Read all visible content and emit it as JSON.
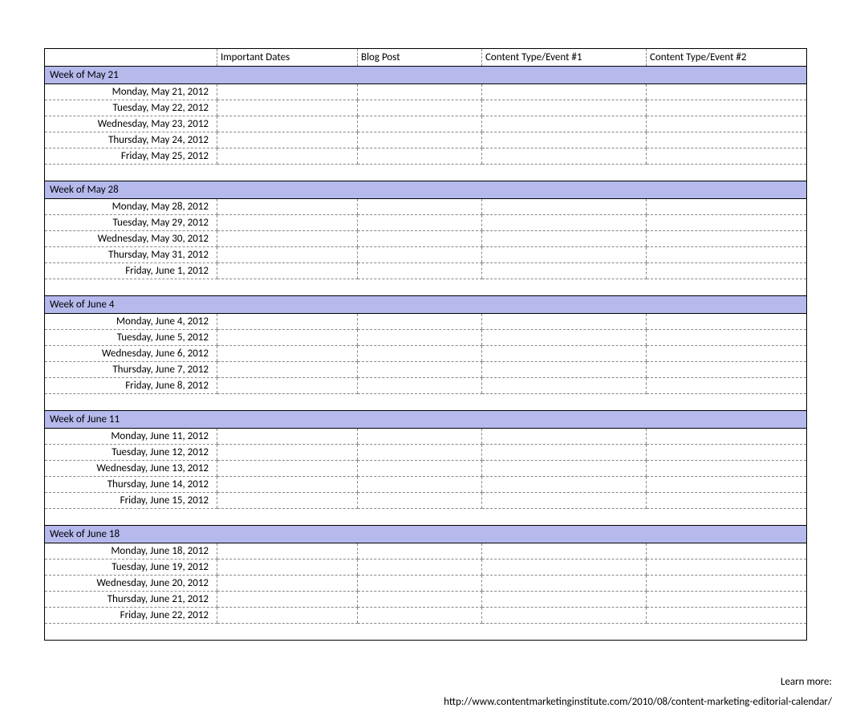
{
  "columns": [
    "",
    "Important Dates",
    "Blog Post",
    "Content Type/Event #1",
    "Content Type/Event #2"
  ],
  "weeks": [
    {
      "label": "Week of May 21",
      "days": [
        "Monday, May 21, 2012",
        "Tuesday, May 22, 2012",
        "Wednesday, May 23, 2012",
        "Thursday, May 24, 2012",
        "Friday, May 25, 2012"
      ]
    },
    {
      "label": "Week of May 28",
      "days": [
        "Monday, May 28, 2012",
        "Tuesday, May 29, 2012",
        "Wednesday, May 30, 2012",
        "Thursday, May 31, 2012",
        "Friday, June 1, 2012"
      ]
    },
    {
      "label": "Week of June 4",
      "days": [
        "Monday, June 4, 2012",
        "Tuesday, June 5, 2012",
        "Wednesday, June 6, 2012",
        "Thursday, June 7, 2012",
        "Friday, June 8, 2012"
      ]
    },
    {
      "label": "Week of June 11",
      "days": [
        "Monday, June 11, 2012",
        "Tuesday, June 12, 2012",
        "Wednesday, June 13, 2012",
        "Thursday, June 14, 2012",
        "Friday, June 15, 2012"
      ]
    },
    {
      "label": "Week of June 18",
      "days": [
        "Monday, June 18, 2012",
        "Tuesday, June 19, 2012",
        "Wednesday, June 20, 2012",
        "Thursday, June 21, 2012",
        "Friday, June 22, 2012"
      ]
    }
  ],
  "footer": {
    "learn_more": "Learn more:",
    "url": "http://www.contentmarketinginstitute.com/2010/08/content-marketing-editorial-calendar/"
  }
}
